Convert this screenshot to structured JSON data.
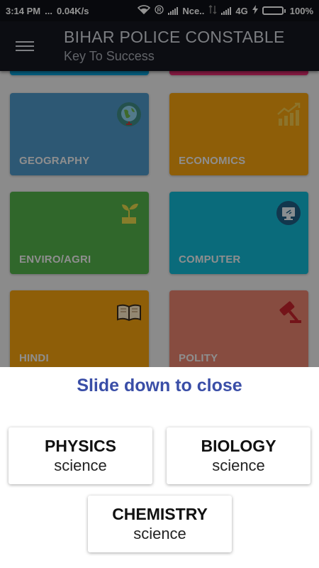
{
  "status_bar": {
    "time": "3:14 PM",
    "dots": "...",
    "speed": "0.04K/s",
    "carrier": "Nce..",
    "network": "4G",
    "battery": "100%"
  },
  "app_bar": {
    "title": "BIHAR POLICE CONSTABLE",
    "subtitle": "Key To Success"
  },
  "categories": [
    {
      "label": "",
      "color": "#0a9fd6",
      "icon": "unknown-icon"
    },
    {
      "label": "",
      "color": "#e62d72",
      "icon": "unknown-icon"
    },
    {
      "label": "GEOGRAPHY",
      "color": "#4f98c8",
      "icon": "globe-icon"
    },
    {
      "label": "ECONOMICS",
      "color": "#f5a30f",
      "icon": "growth-chart-icon"
    },
    {
      "label": "ENVIRO/AGRI",
      "color": "#54b14a",
      "icon": "plant-icon"
    },
    {
      "label": "COMPUTER",
      "color": "#12b9d4",
      "icon": "computer-icon"
    },
    {
      "label": "HINDI",
      "color": "#f5a30f",
      "icon": "book-icon"
    },
    {
      "label": "POLITY",
      "color": "#e8836e",
      "icon": "gavel-icon"
    }
  ],
  "sheet": {
    "hint": "Slide down to close",
    "buttons": [
      {
        "main": "PHYSICS",
        "sub": "science"
      },
      {
        "main": "BIOLOGY",
        "sub": "science"
      },
      {
        "main": "CHEMISTRY",
        "sub": "science"
      }
    ]
  }
}
